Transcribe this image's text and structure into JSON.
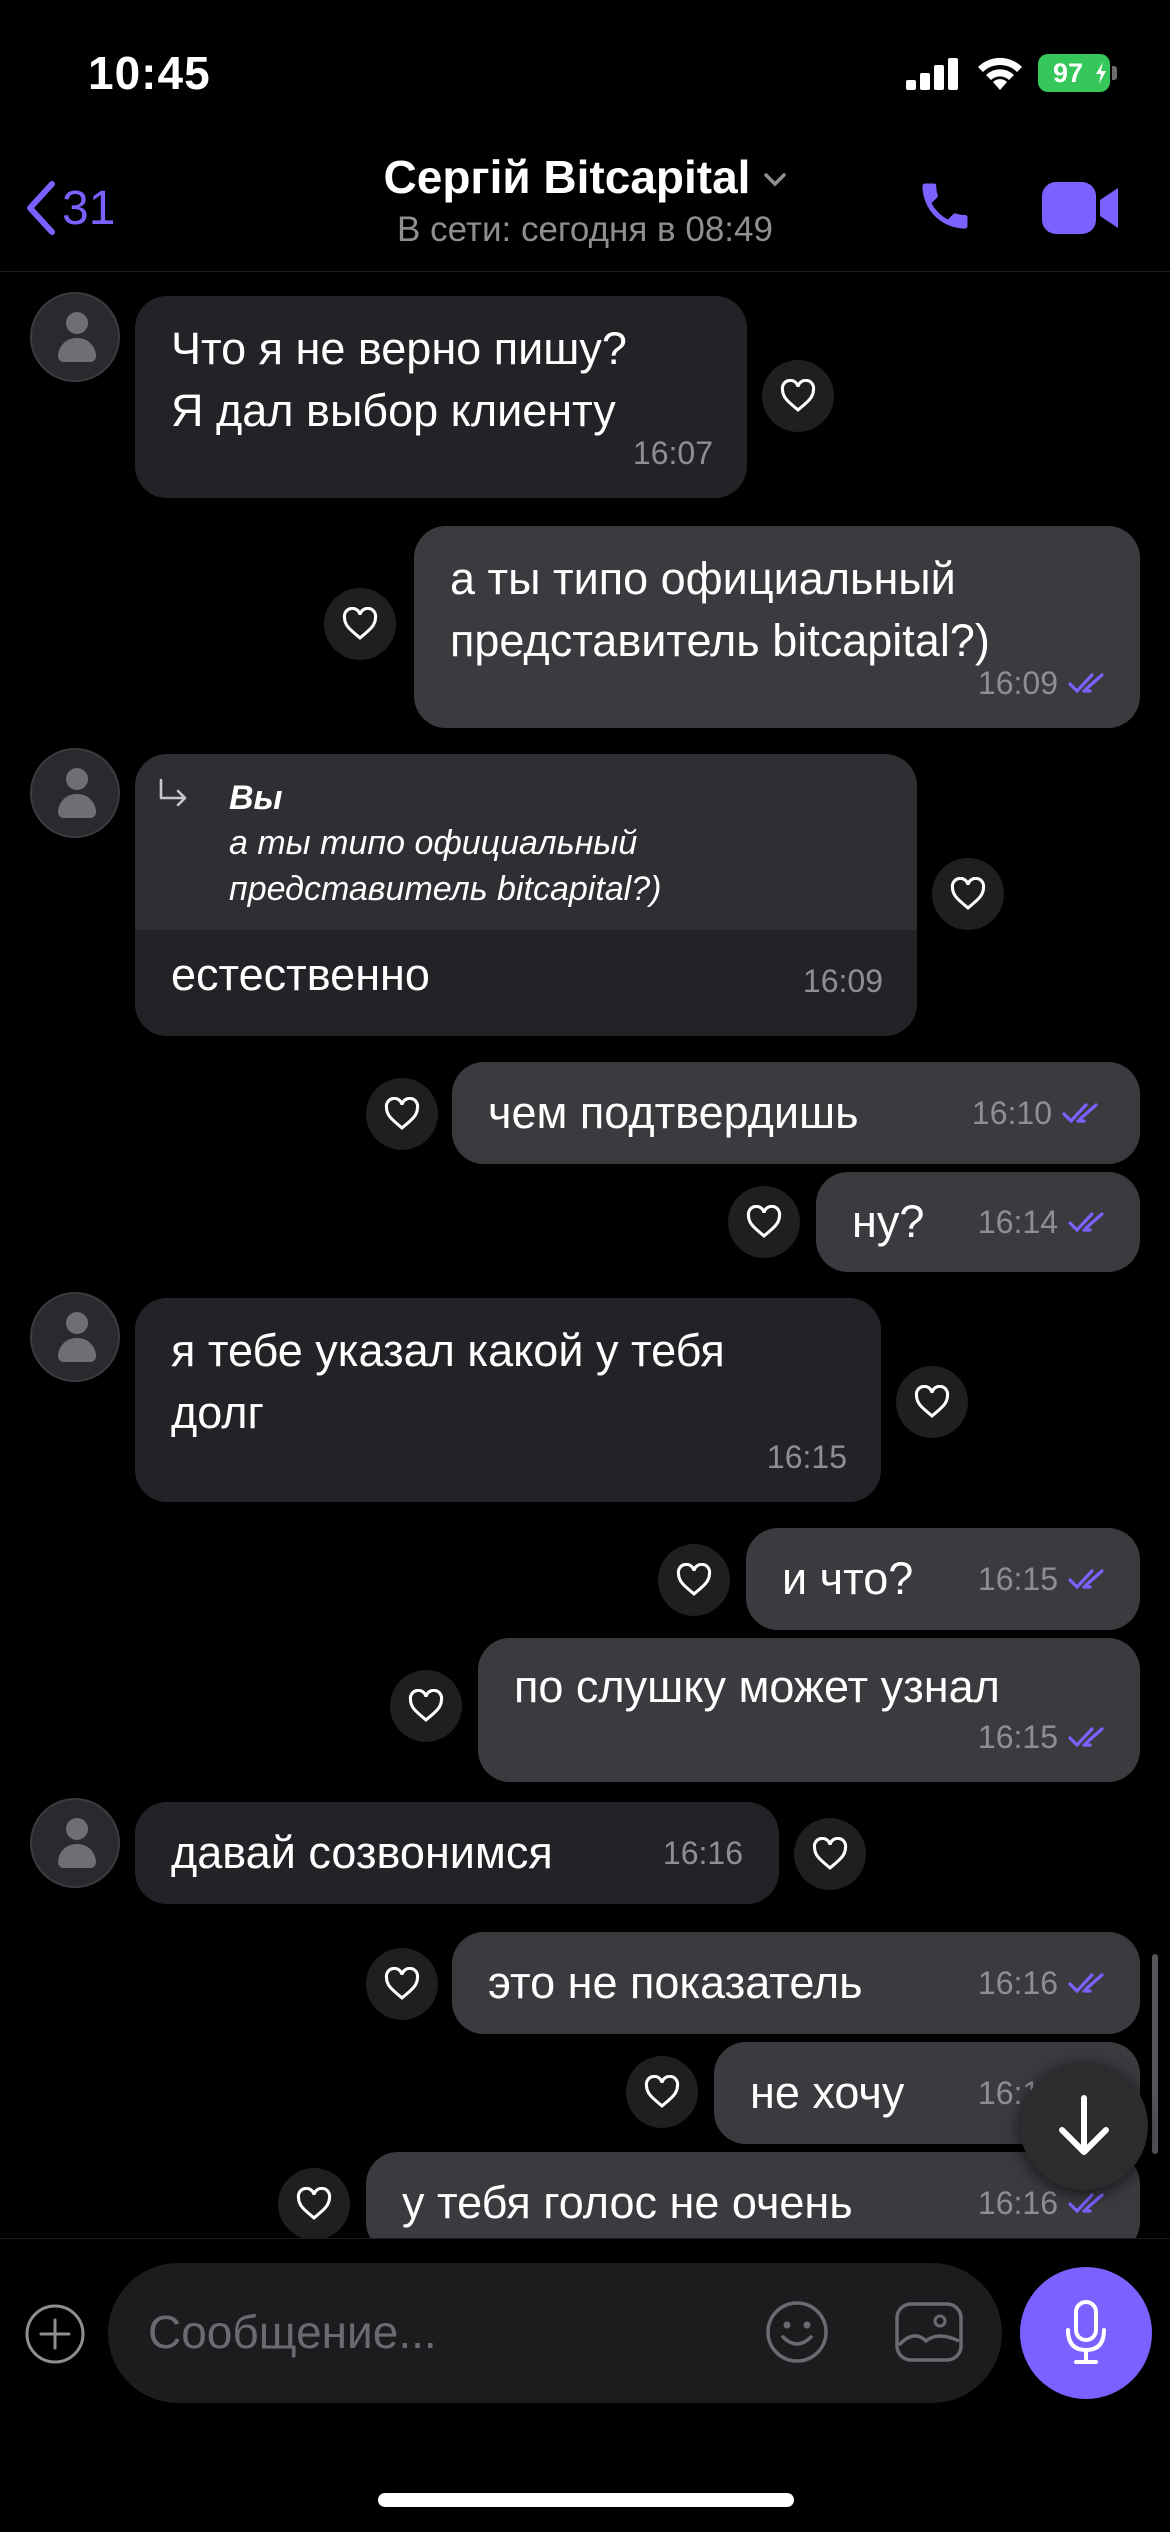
{
  "status_bar": {
    "time": "10:45",
    "battery": "97"
  },
  "header": {
    "back_count": "31",
    "contact_name": "Сергій Bitcapital",
    "presence": "В сети: сегодня в 08:49"
  },
  "messages": [
    {
      "dir": "in",
      "text": "Что я не верно пишу?\nЯ дал выбор клиенту",
      "time": "16:07"
    },
    {
      "dir": "out",
      "text": "а ты типо официальный\nпредставитель bitcapital?)",
      "time": "16:09"
    },
    {
      "dir": "in",
      "reply_author": "Вы",
      "reply_text": "а ты типо официальный\nпредставитель bitcapital?)",
      "text": "естественно",
      "time": "16:09"
    },
    {
      "dir": "out",
      "text": "чем подтвердишь",
      "time": "16:10"
    },
    {
      "dir": "out",
      "text": "ну?",
      "time": "16:14"
    },
    {
      "dir": "in",
      "text": "я тебе указал какой у тебя\nдолг",
      "time": "16:15"
    },
    {
      "dir": "out",
      "text": "и что?",
      "time": "16:15"
    },
    {
      "dir": "out",
      "text": "по слушку может узнал",
      "time": "16:15"
    },
    {
      "dir": "in",
      "text": "давай созвонимся",
      "time": "16:16"
    },
    {
      "dir": "out",
      "text": "это не показатель",
      "time": "16:16"
    },
    {
      "dir": "out",
      "text": "не хочу",
      "time": "16:16"
    },
    {
      "dir": "out",
      "text": "у тебя голос не очень",
      "time": "16:16"
    }
  ],
  "composer": {
    "placeholder": "Сообщение..."
  },
  "icons": {
    "back": "chevron-left-icon",
    "call": "phone-icon",
    "video": "video-camera-icon",
    "like": "heart-icon",
    "read": "double-check-icon",
    "attach": "plus-circle-icon",
    "emoji": "smiley-icon",
    "gallery": "image-icon",
    "mic": "microphone-icon",
    "scroll": "arrow-down-icon"
  },
  "colors": {
    "accent": "#7b61ff",
    "incoming_bubble": "#232327",
    "outgoing_bubble": "#3a3a3f",
    "battery": "#35c759"
  }
}
